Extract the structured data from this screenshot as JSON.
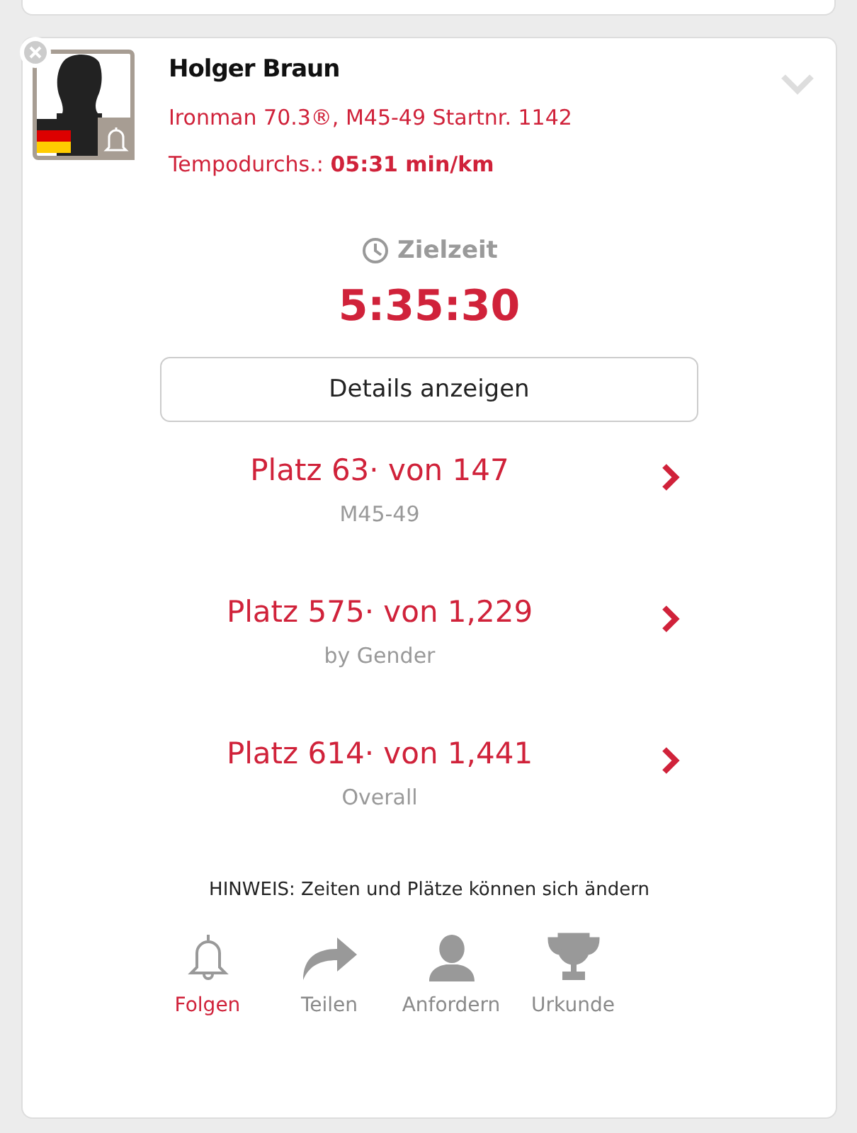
{
  "athlete": {
    "name": "Holger Braun",
    "race_line": "Ironman 70.3®, M45-49 Startnr. 1142",
    "pace_label": "Tempodurchs.:",
    "pace_value": "05:31 min/km",
    "expanded": false
  },
  "finish": {
    "label": "Zielzeit",
    "time": "5:35:30"
  },
  "details_button": "Details anzeigen",
  "rankings": [
    {
      "place": "Platz 63· von 147",
      "category": "M45-49"
    },
    {
      "place": "Platz 575· von 1,229",
      "category": "by Gender"
    },
    {
      "place": "Platz 614· von 1,441",
      "category": "Overall"
    }
  ],
  "note": "HINWEIS: Zeiten und Plätze können sich ändern",
  "actions": [
    {
      "kind": "bell",
      "label": "Folgen",
      "selected": true
    },
    {
      "kind": "share",
      "label": "Teilen",
      "selected": false
    },
    {
      "kind": "person",
      "label": "Anfordern",
      "selected": false
    },
    {
      "kind": "trophy",
      "label": "Urkunde",
      "selected": false
    }
  ]
}
